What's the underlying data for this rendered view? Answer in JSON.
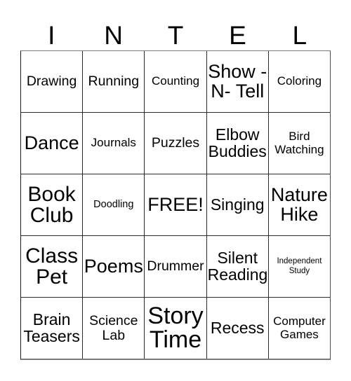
{
  "card": {
    "title_letters": [
      "I",
      "N",
      "T",
      "E",
      "L"
    ],
    "free_space_label": "FREE!",
    "rows": [
      [
        {
          "label": "Drawing",
          "size": "lg"
        },
        {
          "label": "Running",
          "size": "lg"
        },
        {
          "label": "Counting",
          "size": "md"
        },
        {
          "label": "Show -\nN- Tell",
          "size": "2xl"
        },
        {
          "label": "Coloring",
          "size": "md"
        }
      ],
      [
        {
          "label": "Dance",
          "size": "2xl"
        },
        {
          "label": "Journals",
          "size": "md"
        },
        {
          "label": "Puzzles",
          "size": "lg"
        },
        {
          "label": "Elbow\nBuddies",
          "size": "xl"
        },
        {
          "label": "Bird\nWatching",
          "size": "md"
        }
      ],
      [
        {
          "label": "Book\nClub",
          "size": "3xl"
        },
        {
          "label": "Doodling",
          "size": "sm"
        },
        {
          "label": "FREE!",
          "size": "2xl"
        },
        {
          "label": "Singing",
          "size": "xl"
        },
        {
          "label": "Nature\nHike",
          "size": "2xl"
        }
      ],
      [
        {
          "label": "Class\nPet",
          "size": "3xl"
        },
        {
          "label": "Poems",
          "size": "2xl"
        },
        {
          "label": "Drummer",
          "size": "lg"
        },
        {
          "label": "Silent\nReading",
          "size": "xl"
        },
        {
          "label": "Independent\nStudy",
          "size": "xs"
        }
      ],
      [
        {
          "label": "Brain\nTeasers",
          "size": "xl"
        },
        {
          "label": "Science\nLab",
          "size": "lg"
        },
        {
          "label": "Story\nTime",
          "size": "4xl"
        },
        {
          "label": "Recess",
          "size": "xl"
        },
        {
          "label": "Computer\nGames",
          "size": "md"
        }
      ]
    ]
  },
  "colors": {
    "background": "#ffffff",
    "text": "#000000",
    "grid_line": "#2b2b2b",
    "outer_border": "#787878"
  }
}
